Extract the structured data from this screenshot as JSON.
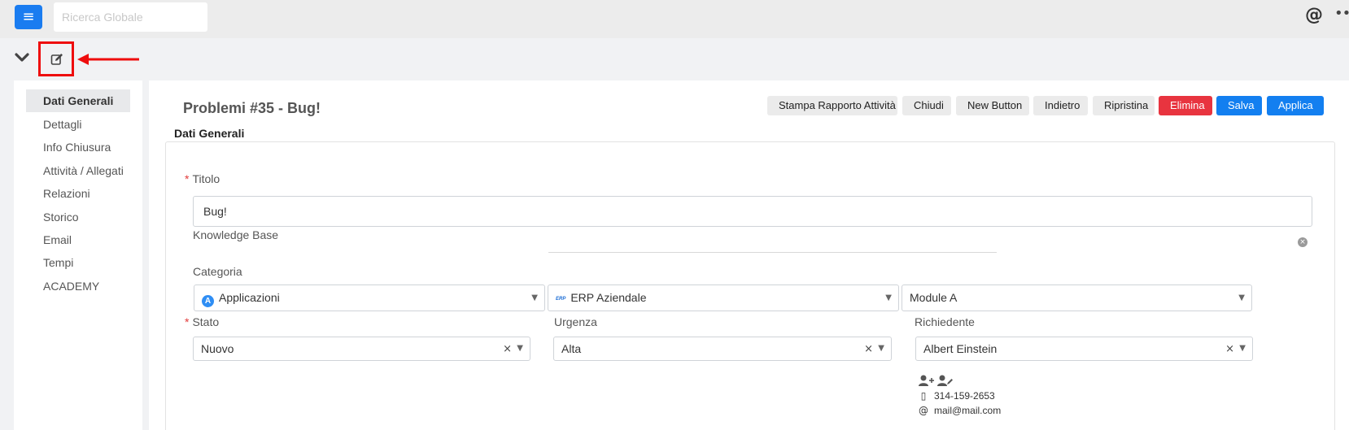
{
  "topbar": {
    "menu_icon": "hamburger-icon",
    "search_placeholder": "Ricerca Globale",
    "at_symbol": "@",
    "more_symbol": "•••"
  },
  "toolbar": {
    "collapse_icon": "chevron-down-icon",
    "edit_icon": "edit-icon",
    "highlight_color": "#ee0d0d"
  },
  "sidebar": {
    "items": [
      {
        "label": "Dati Generali",
        "active": true
      },
      {
        "label": "Dettagli"
      },
      {
        "label": "Info Chiusura"
      },
      {
        "label": "Attività / Allegati"
      },
      {
        "label": "Relazioni"
      },
      {
        "label": "Storico"
      },
      {
        "label": "Email"
      },
      {
        "label": "Tempi"
      },
      {
        "label": "ACADEMY"
      }
    ]
  },
  "header": {
    "title": "Problemi #35 - Bug!",
    "section": "Dati Generali"
  },
  "actions": {
    "print_report": "Stampa Rapporto Attività",
    "close": "Chiudi",
    "new_button": "New Button",
    "back": "Indietro",
    "restore": "Ripristina",
    "delete": "Elimina",
    "save": "Salva",
    "apply": "Applica",
    "colors": {
      "danger": "#e8343f",
      "primary": "#137ff0"
    }
  },
  "form": {
    "title_label": "Titolo",
    "title_value": "Bug!",
    "kb_label": "Knowledge Base",
    "category_label": "Categoria",
    "category_1": "Applicazioni",
    "category_1_badge": "A",
    "category_2": "ERP Aziendale",
    "category_2_badge": "ERP",
    "category_3": "Module A",
    "state_label": "Stato",
    "state_value": "Nuovo",
    "urgency_label": "Urgenza",
    "urgency_value": "Alta",
    "requester_label": "Richiedente",
    "requester_value": "Albert Einstein",
    "requester_phone": "314-159-2653",
    "requester_email": "mail@mail.com",
    "required_mark": "*",
    "clear_symbol": "×",
    "caret_symbol": "▼"
  }
}
